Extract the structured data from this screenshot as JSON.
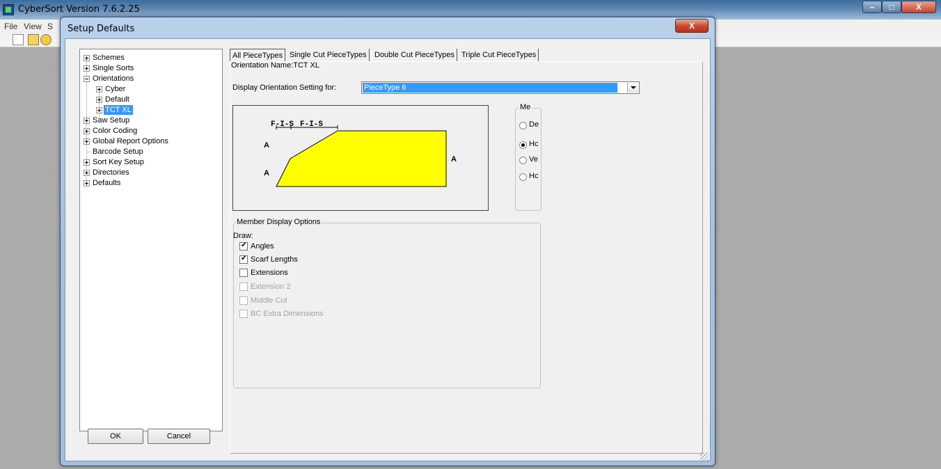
{
  "main_window": {
    "title": "CyberSort Version 7.6.2.25",
    "menu": [
      "File",
      "View",
      "S"
    ]
  },
  "dialog": {
    "title": "Setup Defaults",
    "close_label": "X",
    "tree": [
      "Schemes",
      "Single Sorts",
      "Orientations",
      "Cyber",
      "Default",
      "TCT XL",
      "Saw Setup",
      "Color Coding",
      "Global Report Options",
      "Barcode Setup",
      "Sort Key Setup",
      "Directories",
      "Defaults"
    ],
    "ok_label": "OK",
    "cancel_label": "Cancel",
    "tabs": [
      "All PieceTypes",
      "Single Cut PieceTypes",
      "Double Cut PieceTypes",
      "Triple Cut PieceTypes"
    ],
    "orientation_name": "Orientation Name:TCT XL",
    "display_setting_label": "Display Orientation Setting for:",
    "selected_piece_type": "PieceType 6",
    "diagram": {
      "fis_label_1": "F-I-S",
      "fis_label_2": "F-I-S",
      "angle_labels": [
        "A",
        "A",
        "A"
      ],
      "fill_color": "#ffff00"
    },
    "me_group": {
      "title": "Me",
      "options": [
        "De",
        "Hc",
        "Ve",
        "Hc"
      ],
      "selected_index": 1
    },
    "member_display": {
      "title": "Member Display Options",
      "draw_label": "Draw:",
      "options": [
        {
          "label": "Angles",
          "checked": true,
          "enabled": true
        },
        {
          "label": "Scarf Lengths",
          "checked": true,
          "enabled": true
        },
        {
          "label": "Extensions",
          "checked": false,
          "enabled": true
        },
        {
          "label": "Extension 2",
          "checked": false,
          "enabled": false
        },
        {
          "label": "Middle Cut",
          "checked": false,
          "enabled": false
        },
        {
          "label": "BC Extra Dimensions",
          "checked": false,
          "enabled": false
        }
      ]
    }
  }
}
